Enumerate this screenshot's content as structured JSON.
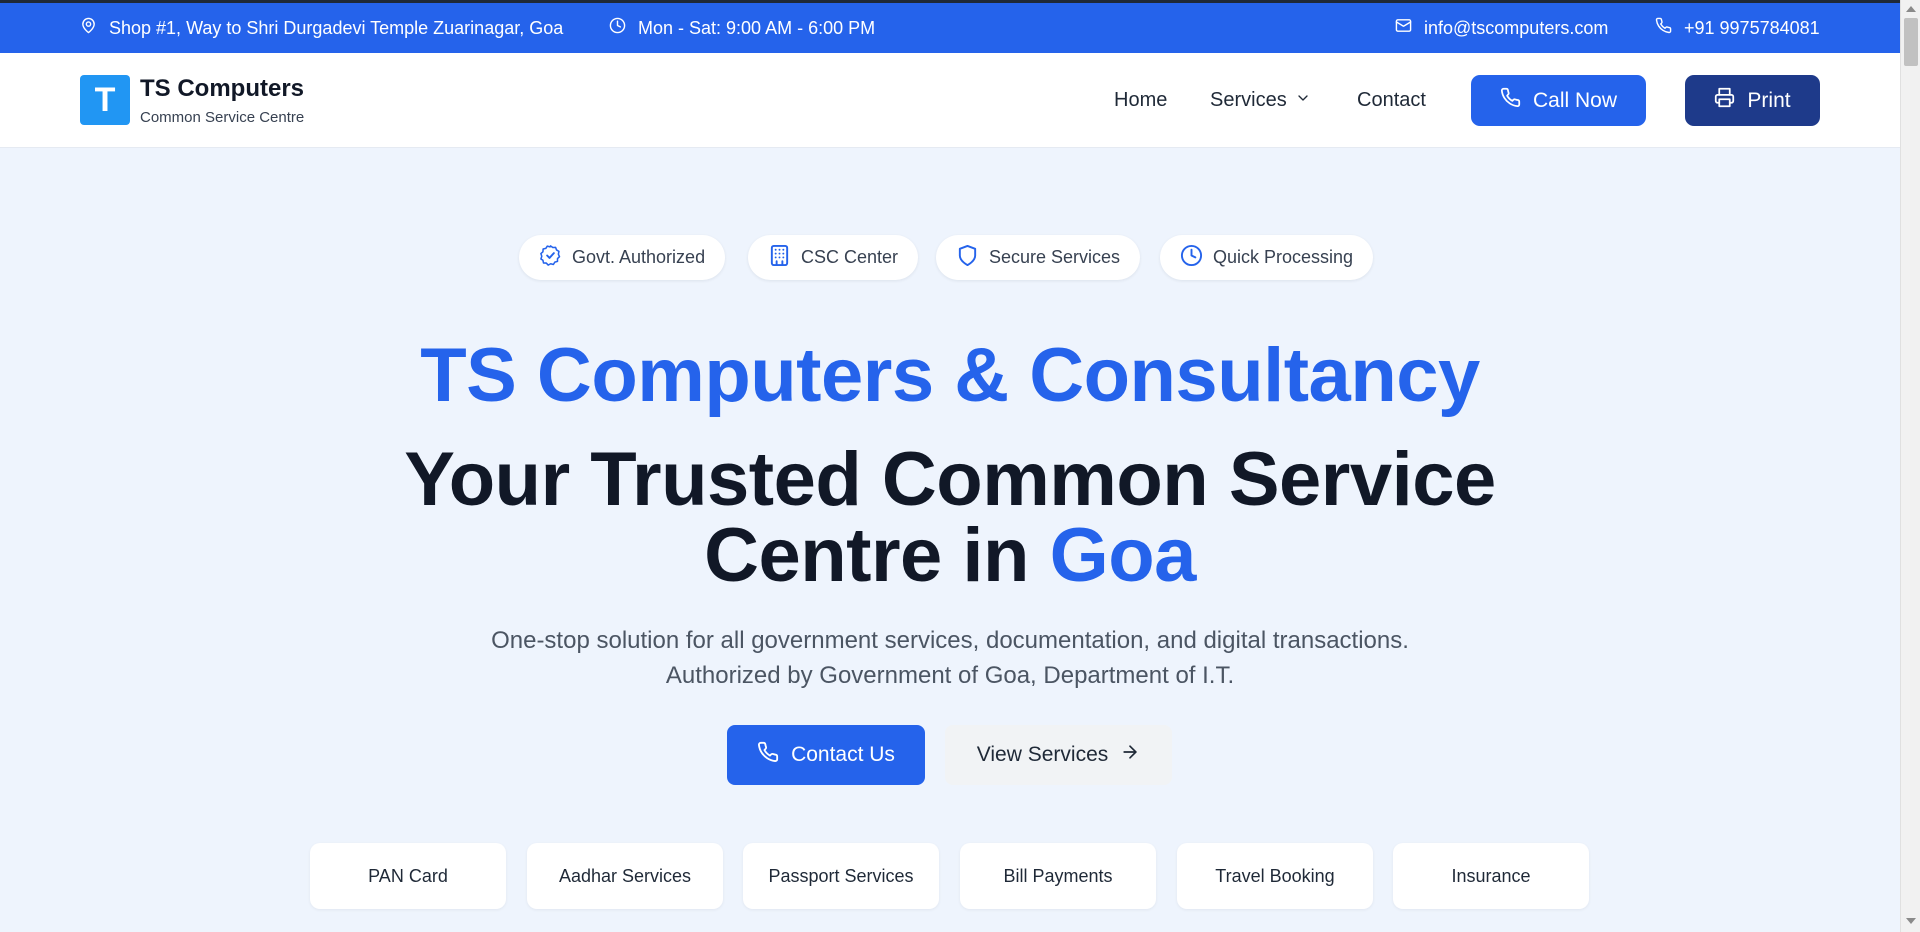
{
  "topbar": {
    "address": "Shop #1, Way to Shri Durgadevi Temple Zuarinagar, Goa",
    "hours": "Mon - Sat: 9:00 AM - 6:00 PM",
    "email": "info@tscomputers.com",
    "phone": "+91 9975784081"
  },
  "header": {
    "logo_letter": "T",
    "brand_name": "TS Computers",
    "brand_sub": "Common Service Centre",
    "nav": {
      "home": "Home",
      "services": "Services",
      "contact": "Contact"
    },
    "call_label": "Call Now",
    "print_label": "Print"
  },
  "badges": [
    "Govt. Authorized",
    "CSC Center",
    "Secure Services",
    "Quick Processing"
  ],
  "hero": {
    "brand": "TS Computers & Consultancy",
    "title_main": "Your Trusted Common Service Centre in",
    "title_accent": "Goa",
    "description": "One-stop solution for all government services, documentation, and digital transactions. Authorized by Government of Goa, Department of I.T.",
    "contact_label": "Contact Us",
    "services_label": "View Services"
  },
  "service_tiles": [
    "PAN Card",
    "Aadhar Services",
    "Passport Services",
    "Bill Payments",
    "Travel Booking",
    "Insurance"
  ],
  "colors": {
    "primary": "#2563eb",
    "dark_button": "#1e3a8a",
    "logo": "#2196f3",
    "background": "#eef4fd"
  }
}
